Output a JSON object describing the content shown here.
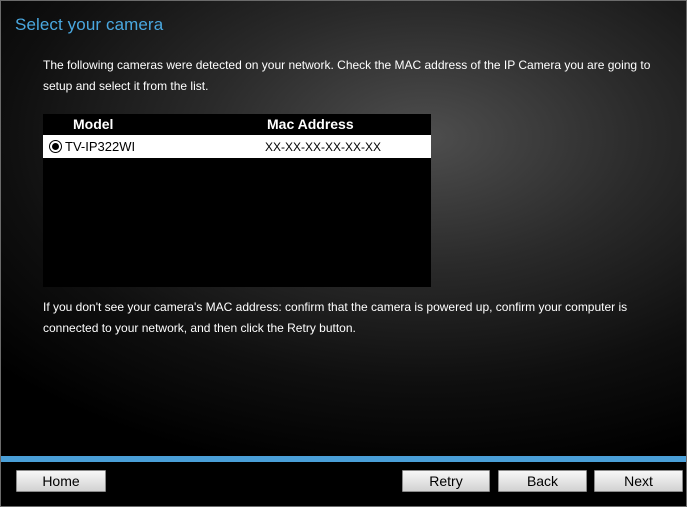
{
  "page": {
    "title": "Select your camera",
    "intro": "The following cameras were detected on your network. Check the MAC address of the IP Camera you are going to setup and select it from the list.",
    "help": "If you don't see your camera's MAC address: confirm that the camera is powered up, confirm your computer is connected to your network, and then click the Retry button."
  },
  "camera_list": {
    "columns": {
      "model": "Model",
      "mac": "Mac Address"
    },
    "rows": [
      {
        "model": "TV-IP322WI",
        "mac": "XX-XX-XX-XX-XX-XX",
        "selected": true
      }
    ]
  },
  "footer": {
    "home_label": "Home",
    "retry_label": "Retry",
    "back_label": "Back",
    "next_label": "Next"
  },
  "colors": {
    "title": "#4aa8e0",
    "accent_bar": "#4a9fd8",
    "background": "#000000",
    "text": "#ffffff"
  }
}
